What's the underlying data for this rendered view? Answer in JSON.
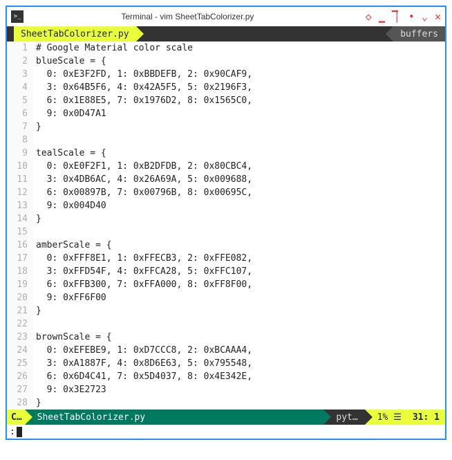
{
  "window": {
    "title": "Terminal - vim SheetTabColorizer.py"
  },
  "tabs": {
    "active": "SheetTabColorizer.py",
    "buffers_label": "buffers"
  },
  "code_lines": [
    {
      "n": 1,
      "t": "# Google Material color scale"
    },
    {
      "n": 2,
      "t": "blueScale = {"
    },
    {
      "n": 3,
      "t": "  0: 0xE3F2FD, 1: 0xBBDEFB, 2: 0x90CAF9,"
    },
    {
      "n": 4,
      "t": "  3: 0x64B5F6, 4: 0x42A5F5, 5: 0x2196F3,"
    },
    {
      "n": 5,
      "t": "  6: 0x1E88E5, 7: 0x1976D2, 8: 0x1565C0,"
    },
    {
      "n": 6,
      "t": "  9: 0x0D47A1"
    },
    {
      "n": 7,
      "t": "}"
    },
    {
      "n": 8,
      "t": ""
    },
    {
      "n": 9,
      "t": "tealScale = {"
    },
    {
      "n": 10,
      "t": "  0: 0xE0F2F1, 1: 0xB2DFDB, 2: 0x80CBC4,"
    },
    {
      "n": 11,
      "t": "  3: 0x4DB6AC, 4: 0x26A69A, 5: 0x009688,"
    },
    {
      "n": 12,
      "t": "  6: 0x00897B, 7: 0x00796B, 8: 0x00695C,"
    },
    {
      "n": 13,
      "t": "  9: 0x004D40"
    },
    {
      "n": 14,
      "t": "}"
    },
    {
      "n": 15,
      "t": ""
    },
    {
      "n": 16,
      "t": "amberScale = {"
    },
    {
      "n": 17,
      "t": "  0: 0xFFF8E1, 1: 0xFFECB3, 2: 0xFFE082,"
    },
    {
      "n": 18,
      "t": "  3: 0xFFD54F, 4: 0xFFCA28, 5: 0xFFC107,"
    },
    {
      "n": 19,
      "t": "  6: 0xFFB300, 7: 0xFFA000, 8: 0xFF8F00,"
    },
    {
      "n": 20,
      "t": "  9: 0xFF6F00"
    },
    {
      "n": 21,
      "t": "}"
    },
    {
      "n": 22,
      "t": ""
    },
    {
      "n": 23,
      "t": "brownScale = {"
    },
    {
      "n": 24,
      "t": "  0: 0xEFEBE9, 1: 0xD7CCC8, 2: 0xBCAAA4,"
    },
    {
      "n": 25,
      "t": "  3: 0xA1887F, 4: 0x8D6E63, 5: 0x795548,"
    },
    {
      "n": 26,
      "t": "  6: 0x6D4C41, 7: 0x5D4037, 8: 0x4E342E,"
    },
    {
      "n": 27,
      "t": "  9: 0x3E2723"
    },
    {
      "n": 28,
      "t": "}"
    }
  ],
  "status": {
    "mode": "C…",
    "file": "SheetTabColorizer.py",
    "filetype": "pyt…",
    "percent": "1% ☰",
    "position": "31: 1"
  },
  "cmdline": ":"
}
